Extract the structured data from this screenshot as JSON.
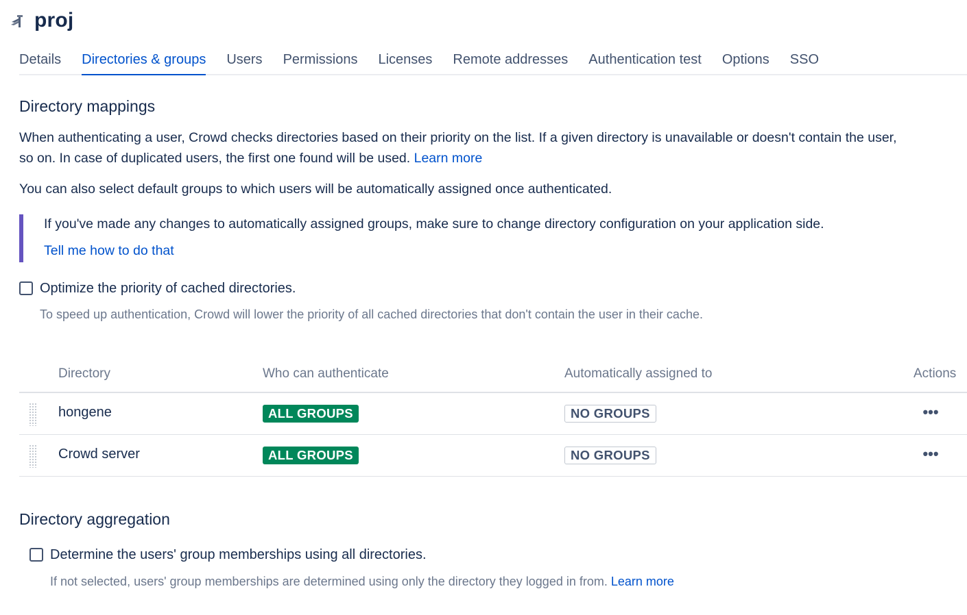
{
  "header": {
    "title": "proj",
    "logo_icon": "crowd-logo-icon"
  },
  "tabs": [
    {
      "label": "Details",
      "active": false
    },
    {
      "label": "Directories & groups",
      "active": true
    },
    {
      "label": "Users",
      "active": false
    },
    {
      "label": "Permissions",
      "active": false
    },
    {
      "label": "Licenses",
      "active": false
    },
    {
      "label": "Remote addresses",
      "active": false
    },
    {
      "label": "Authentication test",
      "active": false
    },
    {
      "label": "Options",
      "active": false
    },
    {
      "label": "SSO",
      "active": false
    }
  ],
  "mappings": {
    "heading": "Directory mappings",
    "intro_line1": "When authenticating a user, Crowd checks directories based on their priority on the list. If a given directory is unavailable or doesn't contain the user,",
    "intro_line2": "so on. In case of duplicated users, the first one found will be used.",
    "learn_more": "Learn more",
    "default_groups_text": "You can also select default groups to which users will be automatically assigned once authenticated.",
    "note_text": "If you've made any changes to automatically assigned groups, make sure to change directory configuration on your application side.",
    "note_link": "Tell me how to do that",
    "optimize_label": "Optimize the priority of cached directories.",
    "optimize_checked": false,
    "optimize_help": "To speed up authentication, Crowd will lower the priority of all cached directories that don't contain the user in their cache."
  },
  "table": {
    "columns": [
      "Directory",
      "Who can authenticate",
      "Automatically assigned to",
      "Actions"
    ],
    "rows": [
      {
        "directory": "hongene",
        "who": "ALL GROUPS",
        "assigned": "NO GROUPS",
        "actions": "•••"
      },
      {
        "directory": "Crowd server",
        "who": "ALL GROUPS",
        "assigned": "NO GROUPS",
        "actions": "•••"
      }
    ]
  },
  "aggregation": {
    "heading": "Directory aggregation",
    "checkbox_label": "Determine the users' group memberships using all directories.",
    "checked": false,
    "help": "If not selected, users' group memberships are determined using only the directory they logged in from.",
    "learn_more": "Learn more"
  },
  "colors": {
    "accent": "#0052cc",
    "note_border": "#6554c0",
    "success_lozenge": "#00875a",
    "text": "#172b4d",
    "subtle_text": "#6b778c"
  }
}
